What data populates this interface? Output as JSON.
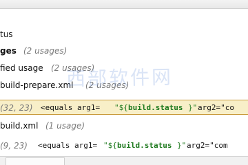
{
  "watermark": "西部软件网",
  "rows": [
    {
      "text": "tus"
    },
    {
      "label": "ges",
      "count": "(2 usages)"
    },
    {
      "label": "fied usage",
      "count": "(2 usages)"
    },
    {
      "label": "build-prepare.xml",
      "count": "(2 usages)"
    },
    {
      "coords": "(32, 23)",
      "prefix": "<equals arg1=",
      "value_open": "\"${",
      "value_mid": "build.status",
      "value_close": "}\"",
      "suffix": " arg2=\"co"
    },
    {
      "label": "build.xml",
      "count": "(1 usage)"
    },
    {
      "coords": "(9, 23)",
      "prefix": "<equals arg1=",
      "value_open": "\"${",
      "value_mid": "build.status",
      "value_close": "}\"",
      "suffix": " arg2=\"com"
    }
  ]
}
